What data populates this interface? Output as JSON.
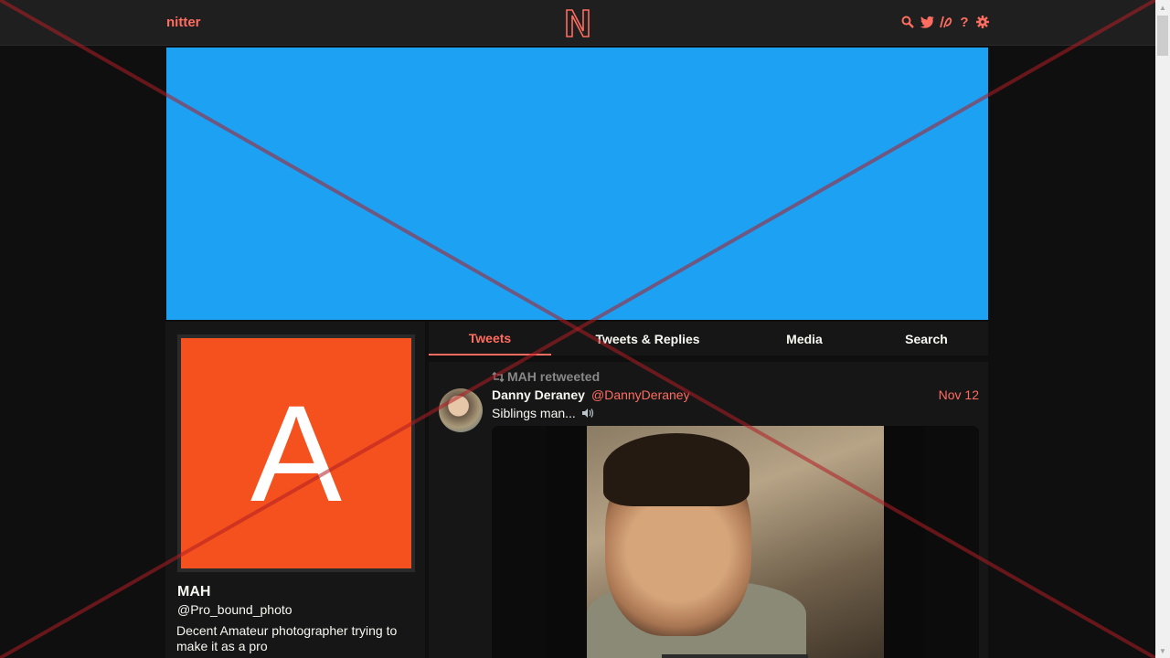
{
  "navbar": {
    "brand": "nitter",
    "logo_letter": "N",
    "icons": [
      "search-icon",
      "twitter-bird-icon",
      "rss-icon",
      "help-icon",
      "gear-icon"
    ],
    "help_glyph": "?"
  },
  "banner": {
    "color": "#1da1f2"
  },
  "profile": {
    "avatar_letter": "A",
    "avatar_color": "#f4511e",
    "fullname": "MAH",
    "username": "@Pro_bound_photo",
    "bio": "Decent Amateur photographer trying to make it as a pro"
  },
  "tabs": [
    {
      "label": "Tweets",
      "active": true
    },
    {
      "label": "Tweets & Replies",
      "active": false
    },
    {
      "label": "Media",
      "active": false
    },
    {
      "label": "Search",
      "active": false
    }
  ],
  "tweet": {
    "retweet_label": "MAH retweeted",
    "fullname": "Danny Deraney",
    "username": "@DannyDeraney",
    "date": "Nov 12",
    "text": "Siblings man..."
  },
  "colors": {
    "accent": "#ff6c60",
    "background": "#0f0f0f",
    "panel": "#161616",
    "navbar": "#1f1f1f"
  }
}
